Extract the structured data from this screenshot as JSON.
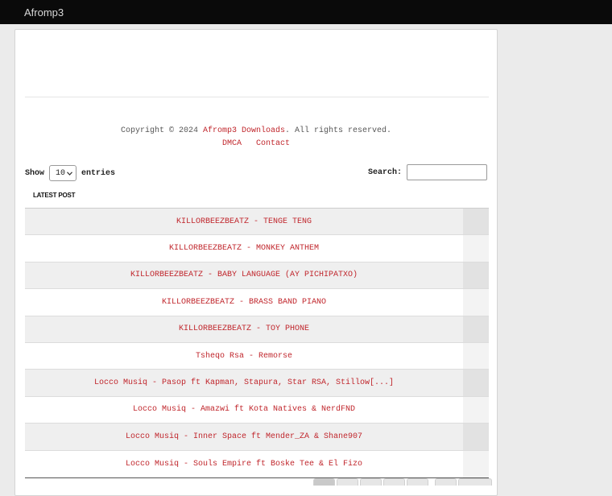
{
  "header": {
    "brand": "Afromp3"
  },
  "footer": {
    "copyright_prefix": "Copyright © 2024 ",
    "copyright_link": "Afromp3 Downloads",
    "copyright_suffix": ". All rights reserved.",
    "links": [
      "DMCA",
      "Contact"
    ]
  },
  "table_controls": {
    "show_label": "Show",
    "entries_value": "10",
    "entries_label": "entries",
    "search_label": "Search:",
    "search_value": ""
  },
  "table": {
    "column_header": "LATEST POST",
    "rows": [
      "KILLORBEEZBEATZ - TENGE TENG",
      "KILLORBEEZBEATZ - MONKEY ANTHEM",
      "KILLORBEEZBEATZ - BABY LANGUAGE (AY PICHIPATXO)",
      "KILLORBEEZBEATZ - BRASS BAND PIANO",
      "KILLORBEEZBEATZ - TOY PHONE",
      "Tsheqo Rsa - Remorse",
      "Locco Musiq - Pasop ft Kapman, Stapura, Star RSA, Stillow[...]",
      "Locco Musiq - Amazwi ft Kota Natives & NerdFND",
      "Locco Musiq - Inner Space ft Mender_ZA & Shane907",
      "Locco Musiq - Souls Empire ft Boske Tee & El Fizo"
    ]
  },
  "colors": {
    "accent": "#c0262c",
    "topbar": "#0a0a0a"
  }
}
